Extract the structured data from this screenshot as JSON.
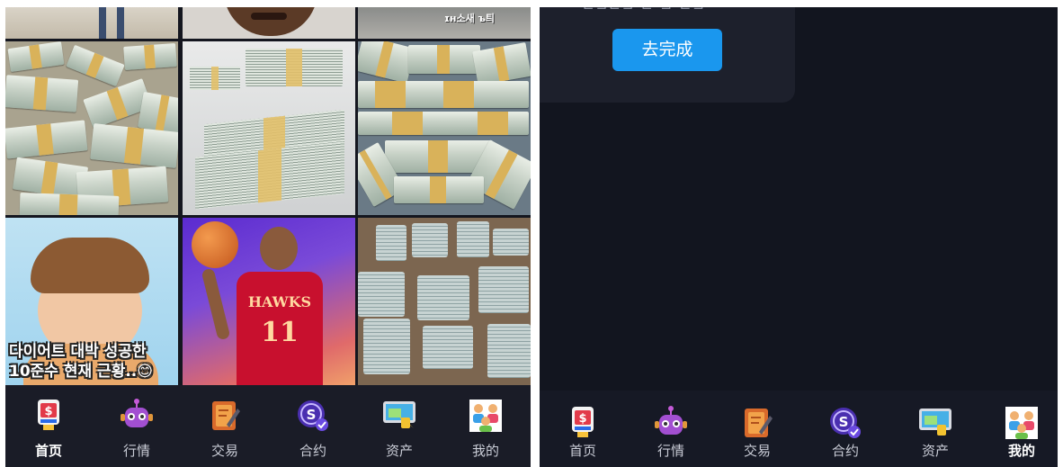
{
  "left_screen": {
    "grid": {
      "top_row_text": "ɪн소새 ъ틔",
      "captions": {
        "weight_loss_caption_line1": "다이어트 대박 성공한",
        "weight_loss_caption_line2": "10준수 현재 근황..😊"
      },
      "player_jersey_team": "HAWKS",
      "player_jersey_number": "11"
    },
    "nav": {
      "items": [
        {
          "label": "首页",
          "icon": "home-icon",
          "active": true
        },
        {
          "label": "行情",
          "icon": "robot-market-icon",
          "active": false
        },
        {
          "label": "交易",
          "icon": "notepad-trade-icon",
          "active": false
        },
        {
          "label": "合约",
          "icon": "coin-contract-icon",
          "active": false
        },
        {
          "label": "资产",
          "icon": "monitor-assets-icon",
          "active": false
        },
        {
          "label": "我的",
          "icon": "people-profile-icon",
          "active": false
        }
      ]
    }
  },
  "right_screen": {
    "card": {
      "partial_text": "⊏⊐⊏⊐ ⊏ ⊐ ⊏⊐",
      "button_label": "去完成"
    },
    "nav": {
      "items": [
        {
          "label": "首页",
          "icon": "home-icon",
          "active": false
        },
        {
          "label": "行情",
          "icon": "robot-market-icon",
          "active": false
        },
        {
          "label": "交易",
          "icon": "notepad-trade-icon",
          "active": false
        },
        {
          "label": "合约",
          "icon": "coin-contract-icon",
          "active": false
        },
        {
          "label": "资产",
          "icon": "monitor-assets-icon",
          "active": false
        },
        {
          "label": "我的",
          "icon": "people-profile-icon",
          "active": true
        }
      ]
    }
  },
  "colors": {
    "background": "#14161f",
    "nav_background": "#1a1c27",
    "button": "#1a97ee",
    "card": "#1d202c"
  }
}
